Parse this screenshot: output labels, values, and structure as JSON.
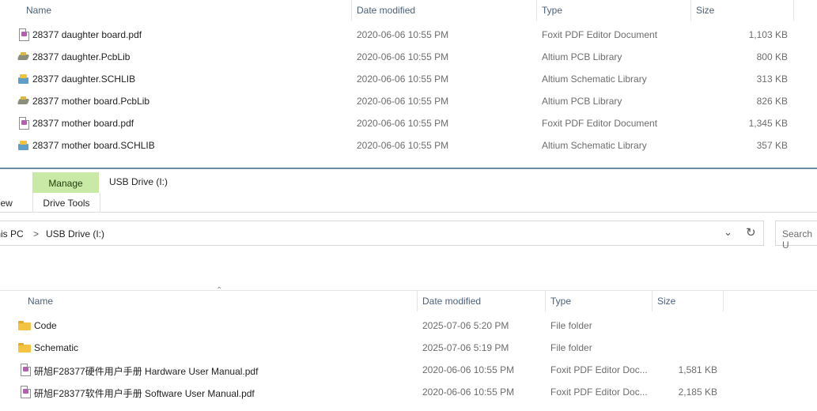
{
  "top_list": {
    "headers": {
      "name": "Name",
      "date": "Date modified",
      "type": "Type",
      "size": "Size"
    },
    "rows": [
      {
        "icon": "pdf-file-icon",
        "name": "28377 daughter board.pdf",
        "date": "2020-06-06 10:55 PM",
        "type": "Foxit PDF Editor Document",
        "size": "1,103 KB"
      },
      {
        "icon": "pcblib-file-icon",
        "name": "28377 daughter.PcbLib",
        "date": "2020-06-06 10:55 PM",
        "type": "Altium PCB Library",
        "size": "800 KB"
      },
      {
        "icon": "schlib-file-icon",
        "name": "28377 daughter.SCHLIB",
        "date": "2020-06-06 10:55 PM",
        "type": "Altium Schematic Library",
        "size": "313 KB"
      },
      {
        "icon": "pcblib-file-icon",
        "name": "28377 mother board.PcbLib",
        "date": "2020-06-06 10:55 PM",
        "type": "Altium PCB Library",
        "size": "826 KB"
      },
      {
        "icon": "pdf-file-icon",
        "name": "28377 mother board.pdf",
        "date": "2020-06-06 10:55 PM",
        "type": "Foxit PDF Editor Document",
        "size": "1,345 KB"
      },
      {
        "icon": "schlib-file-icon",
        "name": "28377 mother board.SCHLIB",
        "date": "2020-06-06 10:55 PM",
        "type": "Altium Schematic Library",
        "size": "357 KB"
      }
    ]
  },
  "ribbon": {
    "view_tab": "View",
    "manage_tab": "Manage",
    "drive_tools": "Drive Tools",
    "window_title": "USB Drive (I:)",
    "accent_color": "#c8eaa6"
  },
  "address": {
    "crumb_root": "This PC",
    "separator": ">",
    "crumb_current": "USB Drive (I:)",
    "search_placeholder": "Search U"
  },
  "bottom_list": {
    "headers": {
      "name": "Name",
      "date": "Date modified",
      "type": "Type",
      "size": "Size"
    },
    "rows": [
      {
        "icon": "folder-icon",
        "name": "Code",
        "date": "2025-07-06 5:20 PM",
        "type": "File folder",
        "size": ""
      },
      {
        "icon": "folder-icon",
        "name": "Schematic",
        "date": "2025-07-06 5:19 PM",
        "type": "File folder",
        "size": ""
      },
      {
        "icon": "pdf-file-icon",
        "name": "研旭F28377硬件用户手册 Hardware User Manual.pdf",
        "date": "2020-06-06 10:55 PM",
        "type": "Foxit PDF Editor Doc...",
        "size": "1,581 KB"
      },
      {
        "icon": "pdf-file-icon",
        "name": "研旭F28377软件用户手册 Software User Manual.pdf",
        "date": "2020-06-06 10:55 PM",
        "type": "Foxit PDF Editor Doc...",
        "size": "2,185 KB"
      }
    ]
  }
}
